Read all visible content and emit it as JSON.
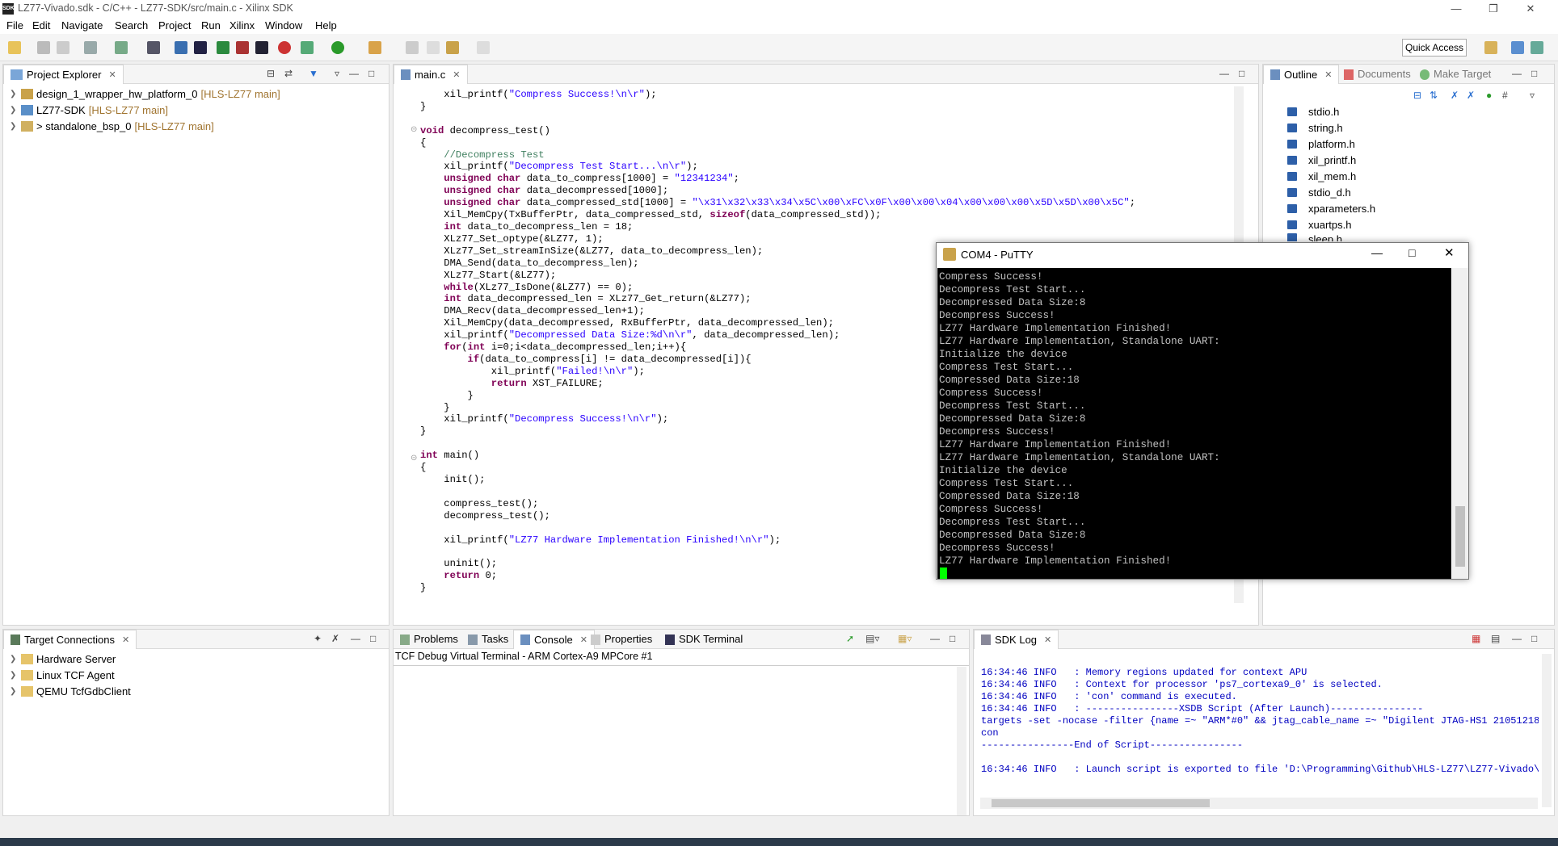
{
  "window": {
    "title": "LZ77-Vivado.sdk - C/C++ - LZ77-SDK/src/main.c - Xilinx SDK",
    "icon_label": "SDK"
  },
  "menu": [
    "File",
    "Edit",
    "Navigate",
    "Search",
    "Project",
    "Run",
    "Xilinx",
    "Window",
    "Help"
  ],
  "toolbar": {
    "quick_access": "Quick Access"
  },
  "project_explorer": {
    "tab": "Project Explorer",
    "items": [
      {
        "name": "design_1_wrapper_hw_platform_0",
        "extra": "[HLS-LZ77 main]"
      },
      {
        "name": "LZ77-SDK",
        "extra": "[HLS-LZ77 main]"
      },
      {
        "name": "> standalone_bsp_0",
        "extra": "[HLS-LZ77 main]"
      }
    ]
  },
  "editor": {
    "tab": "main.c",
    "lines": [
      "    xil_printf(\"Compress Success!\\n\\r\");",
      "}",
      "",
      "void decompress_test()",
      "{",
      "    //Decompress Test",
      "    xil_printf(\"Decompress Test Start...\\n\\r\");",
      "    unsigned char data_to_compress[1000] = \"12341234\";",
      "    unsigned char data_decompressed[1000];",
      "    unsigned char data_compressed_std[1000] = \"\\x31\\x32\\x33\\x34\\x5C\\x00\\xFC\\x0F\\x00\\x00\\x04\\x00\\x00\\x00\\x5D\\x5D\\x00\\x5C\";",
      "    Xil_MemCpy(TxBufferPtr, data_compressed_std, sizeof(data_compressed_std));",
      "    int data_to_decompress_len = 18;",
      "    XLz77_Set_optype(&LZ77, 1);",
      "    XLz77_Set_streamInSize(&LZ77, data_to_decompress_len);",
      "    DMA_Send(data_to_decompress_len);",
      "    XLz77_Start(&LZ77);",
      "    while(XLz77_IsDone(&LZ77) == 0);",
      "    int data_decompressed_len = XLz77_Get_return(&LZ77);",
      "    DMA_Recv(data_decompressed_len+1);",
      "    Xil_MemCpy(data_decompressed, RxBufferPtr, data_decompressed_len);",
      "    xil_printf(\"Decompressed Data Size:%d\\n\\r\", data_decompressed_len);",
      "    for(int i=0;i<data_decompressed_len;i++){",
      "        if(data_to_compress[i] != data_decompressed[i]){",
      "            xil_printf(\"Failed!\\n\\r\");",
      "            return XST_FAILURE;",
      "        }",
      "    }",
      "    xil_printf(\"Decompress Success!\\n\\r\");",
      "}",
      "",
      "int main()",
      "{",
      "    init();",
      "",
      "    compress_test();",
      "    decompress_test();",
      "",
      "    xil_printf(\"LZ77 Hardware Implementation Finished!\\n\\r\");",
      "",
      "    uninit();",
      "    return 0;",
      "}"
    ]
  },
  "outline": {
    "tabs": [
      "Outline",
      "Documents",
      "Make Target"
    ],
    "items": [
      "stdio.h",
      "string.h",
      "platform.h",
      "xil_printf.h",
      "xil_mem.h",
      "stdio_d.h",
      "xparameters.h",
      "xuartps.h",
      "sleep.h"
    ]
  },
  "putty": {
    "title": "COM4 - PuTTY",
    "lines": [
      "Compress Success!",
      "Decompress Test Start...",
      "Decompressed Data Size:8",
      "Decompress Success!",
      "LZ77 Hardware Implementation Finished!",
      "LZ77 Hardware Implementation, Standalone UART:",
      "Initialize the device",
      "Compress Test Start...",
      "Compressed Data Size:18",
      "Compress Success!",
      "Decompress Test Start...",
      "Decompressed Data Size:8",
      "Decompress Success!",
      "LZ77 Hardware Implementation Finished!",
      "LZ77 Hardware Implementation, Standalone UART:",
      "Initialize the device",
      "Compress Test Start...",
      "Compressed Data Size:18",
      "Compress Success!",
      "Decompress Test Start...",
      "Decompressed Data Size:8",
      "Decompress Success!",
      "LZ77 Hardware Implementation Finished!"
    ]
  },
  "target_connections": {
    "tab": "Target Connections",
    "items": [
      "Hardware Server",
      "Linux TCF Agent",
      "QEMU TcfGdbClient"
    ]
  },
  "console": {
    "tabs": [
      "Problems",
      "Tasks",
      "Console",
      "Properties",
      "SDK Terminal"
    ],
    "header": "TCF Debug Virtual Terminal - ARM Cortex-A9 MPCore #1"
  },
  "sdk_log": {
    "tab": "SDK Log",
    "lines": [
      "16:34:46 INFO   : Memory regions updated for context APU",
      "16:34:46 INFO   : Context for processor 'ps7_cortexa9_0' is selected.",
      "16:34:46 INFO   : 'con' command is executed.",
      "16:34:46 INFO   : ----------------XSDB Script (After Launch)----------------",
      "targets -set -nocase -filter {name =~ \"ARM*#0\" && jtag_cable_name =~ \"Digilent JTAG-HS1 210512180",
      "con",
      "----------------End of Script----------------",
      "",
      "16:34:46 INFO   : Launch script is exported to file 'D:\\Programming\\Github\\HLS-LZ77\\LZ77-Vivado\\L"
    ]
  },
  "colors": {
    "keyword": "#7f0055",
    "string": "#2a00ff",
    "comment": "#3f7f5f",
    "log": "#0000c0",
    "cursor": "#00ff00"
  }
}
